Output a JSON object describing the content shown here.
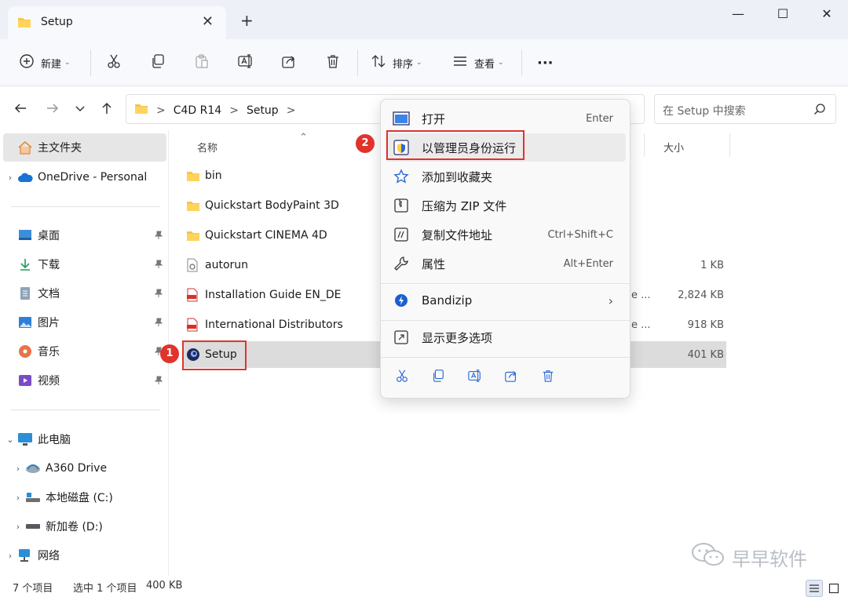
{
  "window": {
    "tab_title": "Setup",
    "tab_close": "✕",
    "new_tab": "+",
    "minimize": "—",
    "maximize": "☐",
    "close": "✕"
  },
  "toolbar": {
    "new_label": "新建",
    "sort_label": "排序",
    "view_label": "查看",
    "more": "···"
  },
  "address": {
    "crumbs": [
      "C4D R14",
      "Setup"
    ],
    "separator": ">",
    "search_placeholder": "在 Setup 中搜索"
  },
  "sidebar": {
    "home": "主文件夹",
    "onedrive": "OneDrive - Personal",
    "quick": [
      "桌面",
      "下载",
      "文档",
      "图片",
      "音乐",
      "视频"
    ],
    "this_pc": "此电脑",
    "drives": [
      "A360 Drive",
      "本地磁盘 (C:)",
      "新加卷 (D:)"
    ],
    "network": "网络"
  },
  "columns": {
    "name": "名称",
    "size": "大小"
  },
  "files": [
    {
      "name": "bin",
      "type": "folder",
      "size": ""
    },
    {
      "name": "Quickstart BodyPaint 3D",
      "type": "folder",
      "size": ""
    },
    {
      "name": "Quickstart CINEMA 4D",
      "type": "folder",
      "size": ""
    },
    {
      "name": "autorun",
      "type": "ini",
      "size": "1 KB"
    },
    {
      "name": "Installation Guide EN_DE",
      "type": "pdf",
      "size": "2,824 KB",
      "extra": "e ..."
    },
    {
      "name": "International Distributors",
      "type": "pdf",
      "size": "918 KB",
      "extra": "e ..."
    },
    {
      "name": "Setup",
      "type": "exe",
      "size": "401 KB"
    }
  ],
  "context_menu": {
    "items": [
      {
        "label": "打开",
        "shortcut": "Enter"
      },
      {
        "label": "以管理员身份运行",
        "shortcut": ""
      },
      {
        "label": "添加到收藏夹",
        "shortcut": ""
      },
      {
        "label": "压缩为 ZIP 文件",
        "shortcut": ""
      },
      {
        "label": "复制文件地址",
        "shortcut": "Ctrl+Shift+C"
      },
      {
        "label": "属性",
        "shortcut": "Alt+Enter"
      },
      {
        "label": "Bandizip",
        "shortcut": ""
      },
      {
        "label": "显示更多选项",
        "shortcut": ""
      }
    ]
  },
  "badges": {
    "one": "1",
    "two": "2"
  },
  "status": {
    "count": "7 个项目",
    "selected": "选中 1 个项目",
    "sel_size": "400 KB"
  },
  "watermark": "早早软件",
  "colors": {
    "highlight": "#e0332c",
    "selection": "#dcdcdc",
    "accent": "#0067c0"
  }
}
